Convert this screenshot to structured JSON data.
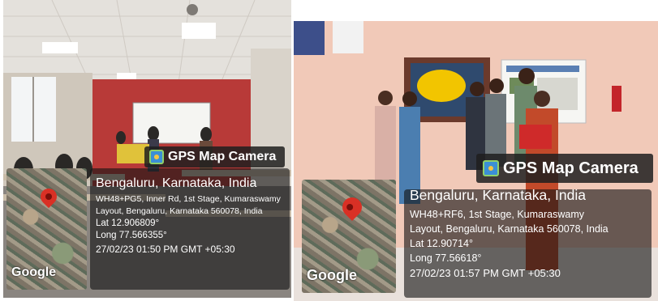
{
  "photos": [
    {
      "app_name": "GPS Map Camera",
      "city": "Bengaluru, Karnataka, India",
      "address_line1": "WH48+PG5, Inner Rd, 1st Stage, Kumaraswamy",
      "address_line2": "Layout, Bengaluru, Karnataka 560078, India",
      "lat": "Lat 12.906809°",
      "long": "Long 77.566355°",
      "timestamp": "27/02/23 01:50 PM GMT +05:30",
      "map_brand": "Google"
    },
    {
      "app_name": "GPS Map Camera",
      "city": "Bengaluru, Karnataka, India",
      "address_line1": "WH48+RF6, 1st Stage, Kumaraswamy",
      "address_line2": "Layout, Bengaluru, Karnataka 560078, India",
      "lat": "Lat 12.90714°",
      "long": "Long 77.56618°",
      "timestamp": "27/02/23 01:57 PM GMT +05:30",
      "map_brand": "Google"
    }
  ],
  "colors": {
    "overlay": "#141414",
    "pin": "#d93025",
    "left_wall": "#b83a38",
    "right_wall": "#f1c9b8"
  }
}
